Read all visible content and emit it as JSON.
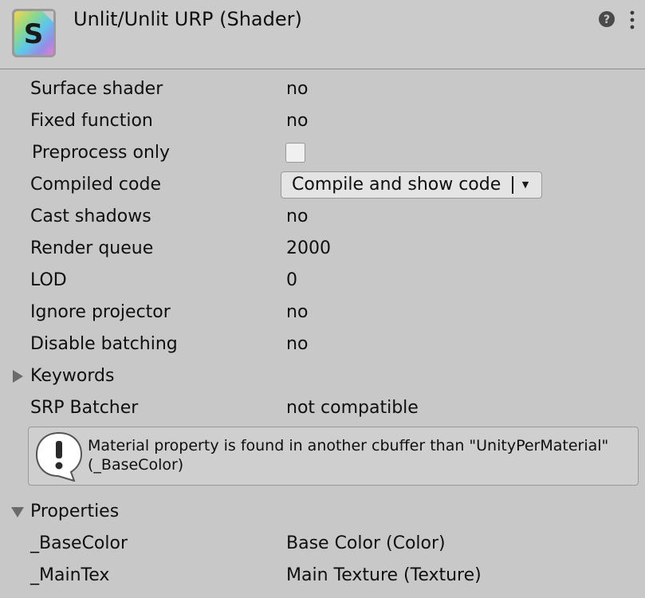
{
  "header": {
    "title": "Unlit/Unlit URP (Shader)",
    "icon_letter": "S",
    "help_icon": "help-icon",
    "menu_icon": "vertical-dots-icon"
  },
  "properties": [
    {
      "label": "Surface shader",
      "value": "no"
    },
    {
      "label": "Fixed function",
      "value": "no"
    },
    {
      "label": "Preprocess only",
      "checked": false
    },
    {
      "label": "Compiled code",
      "dropdown": "Compile and show code"
    },
    {
      "label": "Cast shadows",
      "value": "no"
    },
    {
      "label": "Render queue",
      "value": "2000"
    },
    {
      "label": "LOD",
      "value": "0"
    },
    {
      "label": "Ignore projector",
      "value": "no"
    },
    {
      "label": "Disable batching",
      "value": "no"
    }
  ],
  "keywords": {
    "label": "Keywords",
    "expanded": false
  },
  "srp_batcher": {
    "label": "SRP Batcher",
    "value": "not compatible"
  },
  "warning": {
    "icon": "warning-icon",
    "line1": "Material property is found in another cbuffer than \"UnityPerMaterial\"",
    "line2": "(_BaseColor)"
  },
  "shader_properties": {
    "label": "Properties",
    "expanded": true,
    "items": [
      {
        "name": "_BaseColor",
        "description": "Base Color (Color)"
      },
      {
        "name": "_MainTex",
        "description": "Main Texture (Texture)"
      }
    ]
  },
  "colors": {
    "background": "#c8c8c8",
    "text": "#0f0f0f",
    "divider": "#8c8c8c"
  }
}
